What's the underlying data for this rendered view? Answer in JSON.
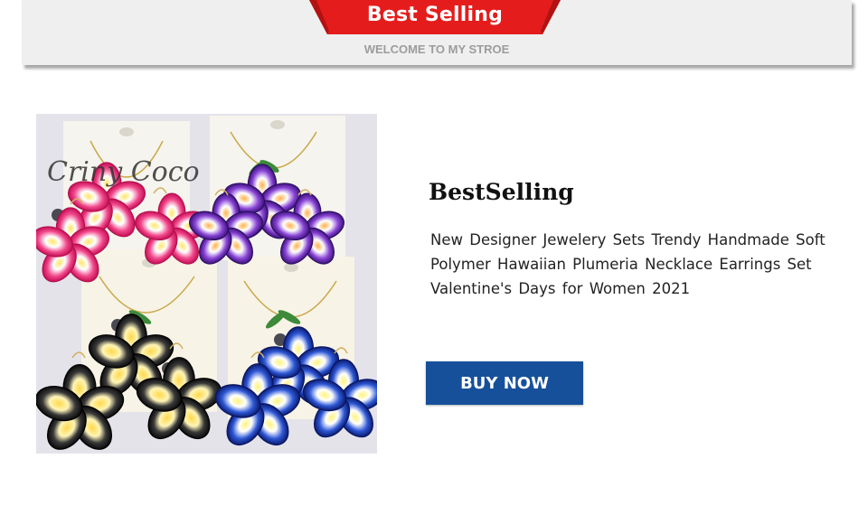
{
  "banner": {
    "title": "Best Selling",
    "subtitle": "WELCOME TO MY STROE",
    "ribbon_color": "#e51c1c",
    "background": "#efefef"
  },
  "product": {
    "brand_watermark": "Criny Coco",
    "headline": "BestSelling",
    "description": "New Designer Jewelery Sets Trendy Handmade Soft Polymer Hawaiian Plumeria Necklace Earrings Set Valentine's Days for Women 2021",
    "image_icon": "jewelry-photo",
    "flower_colors": [
      "#e8206e",
      "#7b2fc4",
      "#111111",
      "#1d3fb3"
    ]
  },
  "cta": {
    "label": "BUY NOW",
    "color": "#17509a"
  }
}
